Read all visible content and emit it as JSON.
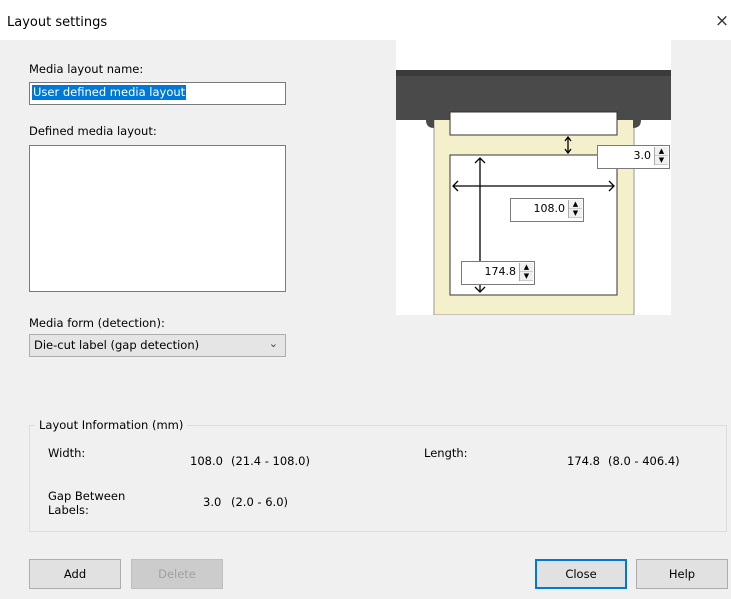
{
  "window": {
    "title": "Layout settings",
    "close_label": "×"
  },
  "media_layout_name": {
    "label": "Media layout name:",
    "value": "User defined media layout"
  },
  "defined_media_layout": {
    "label": "Defined media layout:"
  },
  "media_form": {
    "label": "Media form (detection):",
    "selected": "Die-cut label (gap detection)"
  },
  "diagram": {
    "gap": "3.0",
    "width": "108.0",
    "length": "174.8"
  },
  "layout_info": {
    "title": "Layout Information (mm)",
    "width_label": "Width:",
    "width_value": "108.0",
    "width_range": "(21.4 - 108.0)",
    "length_label": "Length:",
    "length_value": "174.8",
    "length_range": "(8.0 - 406.4)",
    "gap_label_line1": "Gap Between",
    "gap_label_line2": "Labels:",
    "gap_value": "3.0",
    "gap_range": "(2.0 - 6.0)"
  },
  "buttons": {
    "add": "Add",
    "delete": "Delete",
    "close": "Close",
    "help": "Help"
  },
  "colors": {
    "selection": "#0078d7",
    "label_stock": "#f5f0cc",
    "printer": "#4a4a4a"
  }
}
